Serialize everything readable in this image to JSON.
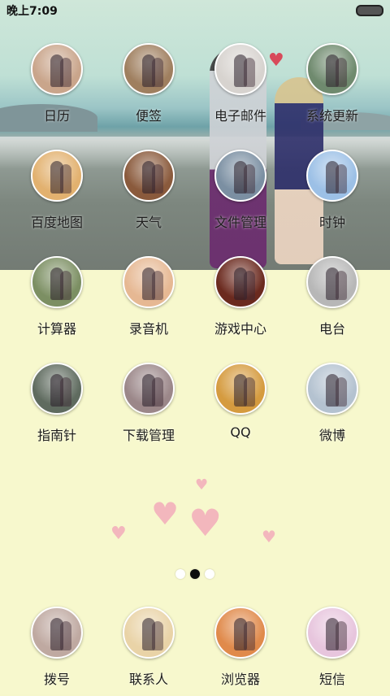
{
  "status_bar": {
    "time": "晚上7:09"
  },
  "apps_row1": [
    {
      "label": "日历",
      "icon": "calendar-icon",
      "bg": "#c9a58b"
    },
    {
      "label": "便签",
      "icon": "notes-icon",
      "bg": "#9f7f5f"
    },
    {
      "label": "电子邮件",
      "icon": "email-icon",
      "bg": "#d7d3cf"
    },
    {
      "label": "系统更新",
      "icon": "system-update-icon",
      "bg": "#6f8a6e"
    }
  ],
  "apps_row2": [
    {
      "label": "百度地图",
      "icon": "map-icon",
      "bg": "#e2b16f"
    },
    {
      "label": "天气",
      "icon": "weather-icon",
      "bg": "#8a5a3c"
    },
    {
      "label": "文件管理",
      "icon": "file-manager-icon",
      "bg": "#7b8fa2"
    },
    {
      "label": "时钟",
      "icon": "clock-icon",
      "bg": "#9cc0e6"
    }
  ],
  "apps_row3": [
    {
      "label": "计算器",
      "icon": "calculator-icon",
      "bg": "#7c8f63"
    },
    {
      "label": "录音机",
      "icon": "recorder-icon",
      "bg": "#e6b893"
    },
    {
      "label": "游戏中心",
      "icon": "game-center-icon",
      "bg": "#6b2a1f"
    },
    {
      "label": "电台",
      "icon": "radio-icon",
      "bg": "#b7b7b7"
    }
  ],
  "apps_row4": [
    {
      "label": "指南针",
      "icon": "compass-icon",
      "bg": "#5f6b5f"
    },
    {
      "label": "下载管理",
      "icon": "download-manager-icon",
      "bg": "#9b8789"
    },
    {
      "label": "QQ",
      "icon": "qq-icon",
      "bg": "#d59b3f"
    },
    {
      "label": "微博",
      "icon": "weibo-icon",
      "bg": "#b4c2d0"
    }
  ],
  "dock": [
    {
      "label": "拨号",
      "icon": "phone-icon",
      "bg": "#bfa9a1"
    },
    {
      "label": "联系人",
      "icon": "contacts-icon",
      "bg": "#e9d3a7"
    },
    {
      "label": "浏览器",
      "icon": "browser-icon",
      "bg": "#e08a4b"
    },
    {
      "label": "短信",
      "icon": "messages-icon",
      "bg": "#e7c5dd"
    }
  ],
  "page_indicator": {
    "count": 3,
    "active_index": 1
  }
}
